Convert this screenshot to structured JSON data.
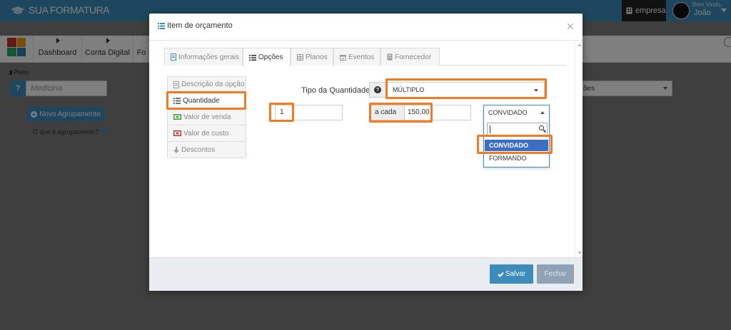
{
  "brand": {
    "name": "SUA FORMATURA"
  },
  "header": {
    "company_label": "empresa",
    "welcome": "Bem Vindo,",
    "user_name": "João"
  },
  "nav": {
    "items": [
      "Dashboard",
      "Conta Digital",
      "Fo"
    ]
  },
  "background": {
    "plano_label": "Plano",
    "plano_value": "Medicina",
    "help_symbol": "?",
    "new_group_label": "Novo Agrupamento",
    "group_help_label": "O que é agrupamento?",
    "right_select_value": "ões"
  },
  "modal": {
    "title": "Item de orçamento",
    "close_symbol": "×",
    "tabs": [
      {
        "label": "Informações gerais",
        "icon": "document-icon",
        "active": false
      },
      {
        "label": "Opções",
        "icon": "list-icon",
        "active": true
      },
      {
        "label": "Planos",
        "icon": "table-icon",
        "active": false
      },
      {
        "label": "Eventos",
        "icon": "calendar-icon",
        "active": false
      },
      {
        "label": "Fornecedor",
        "icon": "building-icon",
        "active": false
      }
    ],
    "side_menu": [
      {
        "label": "Descrição da opção",
        "icon": "document-icon",
        "active": false
      },
      {
        "label": "Quantidade",
        "icon": "ordered-list-icon",
        "active": true
      },
      {
        "label": "Valor de venda",
        "icon": "money-green-icon",
        "active": false
      },
      {
        "label": "Valor de custo",
        "icon": "money-red-icon",
        "active": false
      },
      {
        "label": "Descontos",
        "icon": "arrow-down-icon",
        "active": false
      }
    ],
    "quantity_type_label": "Tipo da Quantidade",
    "quantity_type_value": "MÚLTIPLO",
    "quantity_value": "1",
    "each_label": "a cada",
    "each_value": "150,00",
    "target_dropdown": {
      "selected": "CONVIDADO",
      "options": [
        "CONVIDADO",
        "FORMANDO"
      ]
    },
    "save_label": "Salvar",
    "close_label": "Fechar"
  },
  "colors": {
    "primary": "#3c8dbc",
    "highlight": "#f47920",
    "dark": "#222222"
  }
}
